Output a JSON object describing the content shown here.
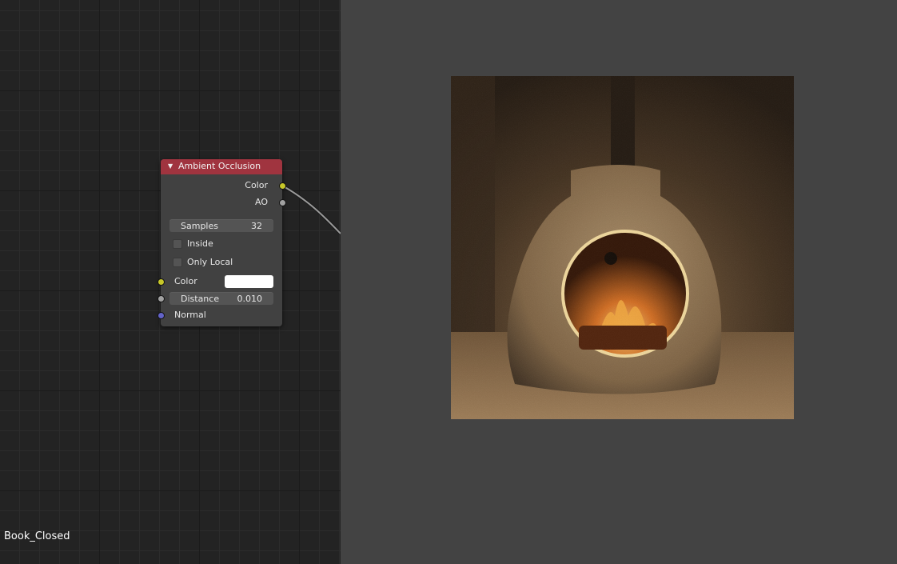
{
  "node_editor": {
    "material_name": "Book_Closed",
    "node": {
      "title": "Ambient Occlusion",
      "outputs": [
        {
          "label": "Color",
          "socket_color": "#c7c729"
        },
        {
          "label": "AO",
          "socket_color": "#a1a1a1"
        }
      ],
      "samples": {
        "label": "Samples",
        "value": "32"
      },
      "inside": {
        "label": "Inside",
        "checked": false
      },
      "only_local": {
        "label": "Only Local",
        "checked": false
      },
      "inputs": {
        "color": {
          "label": "Color",
          "swatch": "#ffffff"
        },
        "distance": {
          "label": "Distance",
          "value": "0.010"
        },
        "normal": {
          "label": "Normal"
        }
      },
      "header_color": "#a0343f"
    }
  },
  "viewer": {
    "background": "#434343",
    "image_subject": "rendered stone fireplace with burning logs"
  }
}
